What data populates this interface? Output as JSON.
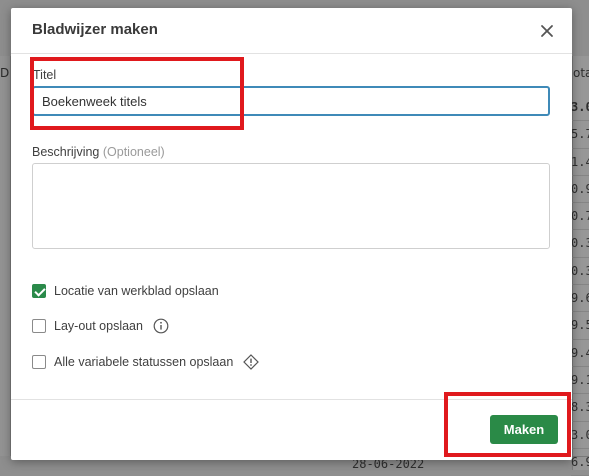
{
  "background": {
    "left_column_header": "D",
    "right_column_header": "ota d",
    "right_column_values": [
      "3.0",
      "5.7",
      "1.4",
      "0.9",
      "0.7",
      "0.3",
      "0.3",
      "9.6",
      "9.5",
      "9.4",
      "9.1",
      "8.3",
      "3.0",
      "6.9"
    ],
    "bottom_date": "28-06-2022"
  },
  "dialog": {
    "title": "Bladwijzer maken",
    "close_icon": "close-icon",
    "title_field": {
      "label": "Titel",
      "value": "Boekenweek titels"
    },
    "description_field": {
      "label": "Beschrijving",
      "optional_note": "(Optioneel)",
      "value": ""
    },
    "options": [
      {
        "label": "Locatie van werkblad opslaan",
        "checked": true
      },
      {
        "label": "Lay-out opslaan",
        "checked": false,
        "icon": "info-icon"
      },
      {
        "label": "Alle variabele statussen opslaan",
        "checked": false,
        "icon": "warning-diamond-icon"
      }
    ],
    "primary_button": "Maken"
  },
  "colors": {
    "accent_focus": "#3f8ab8",
    "primary_button": "#2a8a47",
    "checkbox_checked": "#2a8a4a",
    "annotation_red": "#e0191d"
  }
}
